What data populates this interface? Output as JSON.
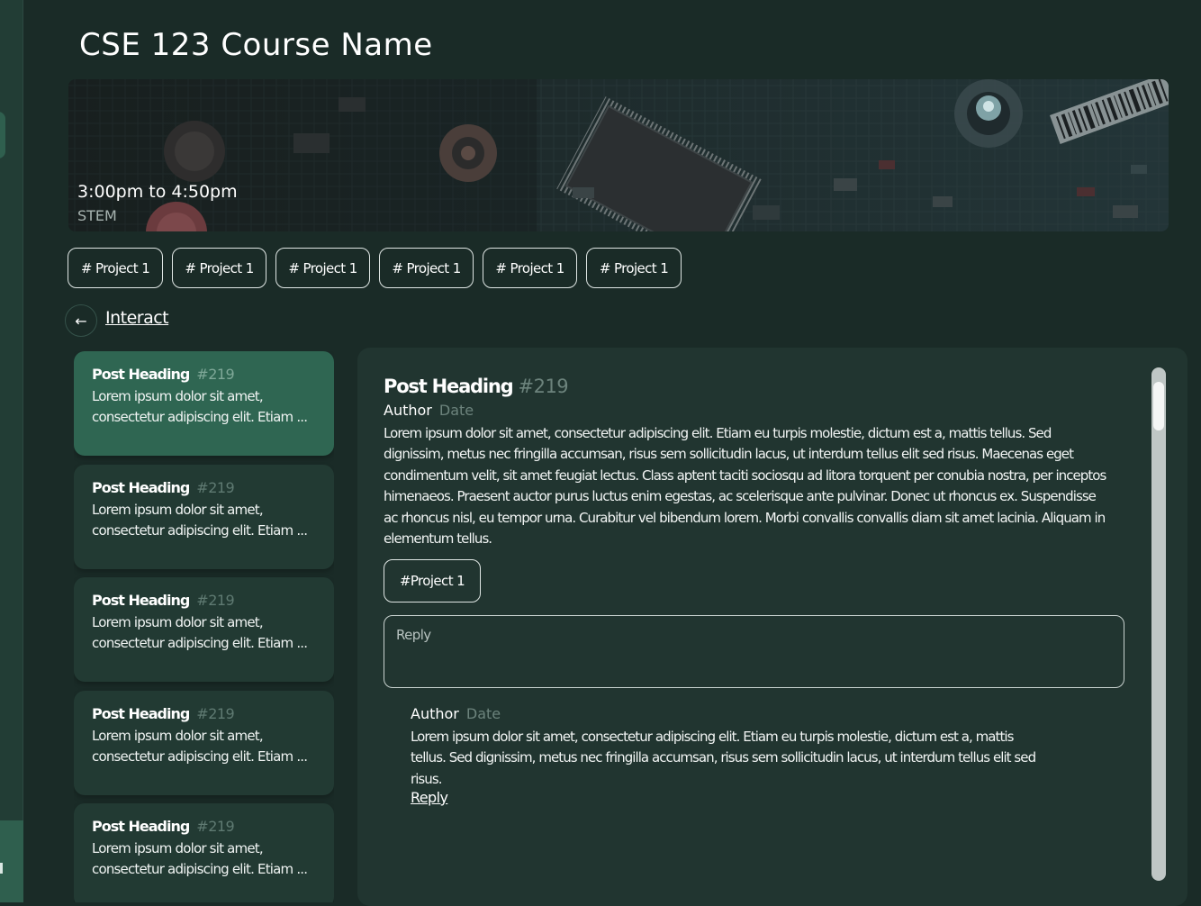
{
  "course": {
    "title": "CSE 123 Course Name",
    "time": "3:00pm to 4:50pm",
    "department": "STEM"
  },
  "tags": [
    "# Project 1",
    "# Project 1",
    "# Project 1",
    "# Project 1",
    "# Project 1",
    "# Project 1"
  ],
  "nav": {
    "back_icon": "←",
    "interact_label": "Interact"
  },
  "posts": [
    {
      "heading": "Post Heading",
      "number": "#219",
      "excerpt": "Lorem ipsum dolor sit amet, consectetur adipiscing elit. Etiam ..."
    },
    {
      "heading": "Post Heading",
      "number": "#219",
      "excerpt": "Lorem ipsum dolor sit amet, consectetur adipiscing elit. Etiam ..."
    },
    {
      "heading": "Post Heading",
      "number": "#219",
      "excerpt": "Lorem ipsum dolor sit amet, consectetur adipiscing elit. Etiam ..."
    },
    {
      "heading": "Post Heading",
      "number": "#219",
      "excerpt": "Lorem ipsum dolor sit amet, consectetur adipiscing elit. Etiam ..."
    },
    {
      "heading": "Post Heading",
      "number": "#219",
      "excerpt": "Lorem ipsum dolor sit amet, consectetur adipiscing elit. Etiam ..."
    }
  ],
  "detail": {
    "heading": "Post Heading",
    "number": "#219",
    "author": "Author",
    "date": "Date",
    "body": "Lorem ipsum dolor sit amet, consectetur adipiscing elit. Etiam eu turpis molestie, dictum est a, mattis tellus. Sed dignissim, metus nec fringilla accumsan, risus sem sollicitudin lacus, ut interdum tellus elit sed risus. Maecenas eget condimentum velit, sit amet feugiat lectus. Class aptent taciti sociosqu ad litora torquent per conubia nostra, per inceptos himenaeos. Praesent auctor purus luctus enim egestas, ac scelerisque ante pulvinar. Donec ut rhoncus ex. Suspendisse ac rhoncus nisl, eu tempor urna. Curabitur vel bibendum lorem. Morbi convallis convallis diam sit amet lacinia. Aliquam in elementum tellus.",
    "tag": "#Project 1",
    "reply_placeholder": "Reply"
  },
  "comment": {
    "author": "Author",
    "date": "Date",
    "body": "Lorem ipsum dolor sit amet, consectetur adipiscing elit. Etiam eu turpis molestie, dictum est a, mattis tellus. Sed dignissim, metus nec fringilla accumsan, risus sem sollicitudin lacus, ut interdum tellus elit sed risus.",
    "reply_label": "Reply"
  },
  "colors": {
    "background": "#1a2b27",
    "sidebar": "#223d35",
    "card": "#223a33",
    "card_active": "#2f6652",
    "panel": "#213530",
    "muted_text": "#6c837c"
  }
}
